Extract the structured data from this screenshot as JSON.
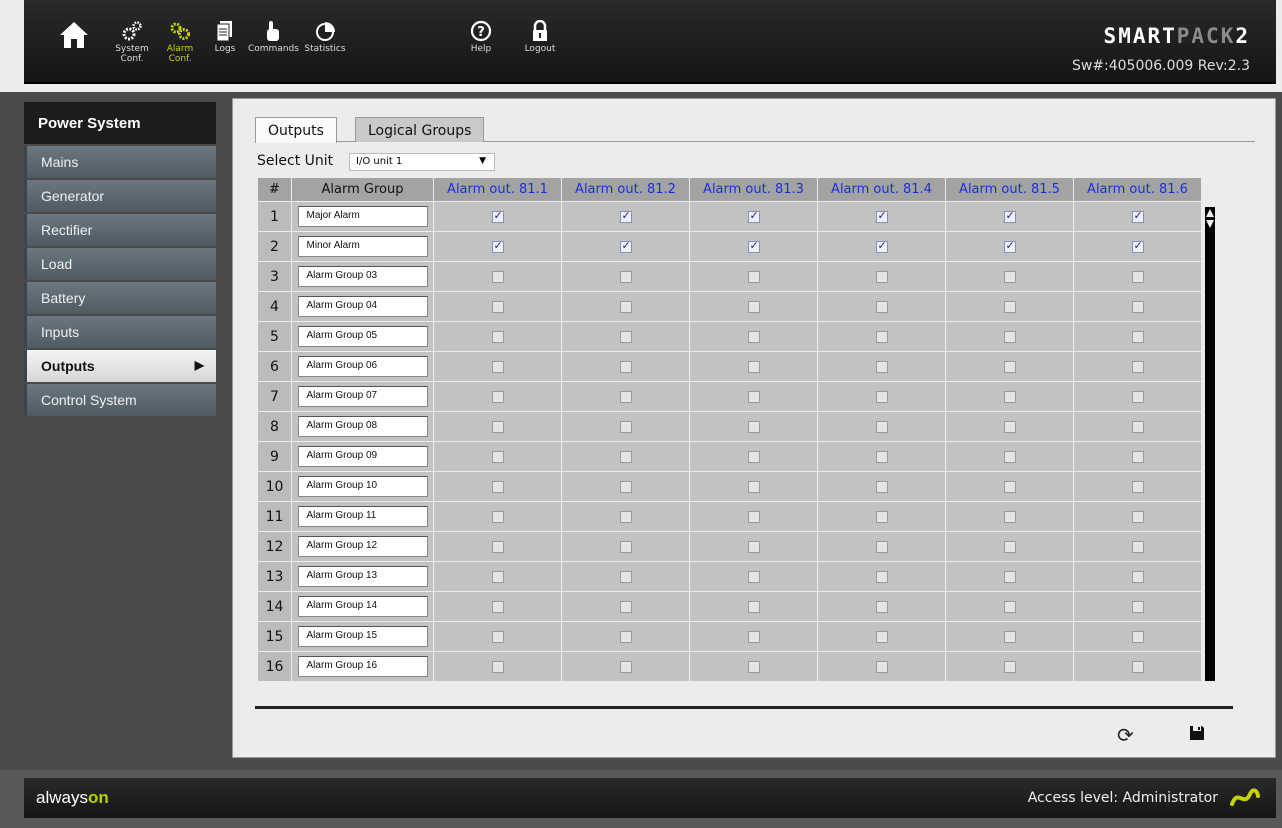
{
  "header": {
    "nav": [
      {
        "name": "home",
        "label1": "",
        "label2": ""
      },
      {
        "name": "system-conf",
        "label1": "System",
        "label2": "Conf."
      },
      {
        "name": "alarm-conf",
        "label1": "Alarm",
        "label2": "Conf."
      },
      {
        "name": "logs",
        "label1": "Logs",
        "label2": ""
      },
      {
        "name": "commands",
        "label1": "Commands",
        "label2": ""
      },
      {
        "name": "statistics",
        "label1": "Statistics",
        "label2": ""
      },
      {
        "name": "help",
        "label1": "Help",
        "label2": ""
      },
      {
        "name": "logout",
        "label1": "Logout",
        "label2": ""
      }
    ],
    "brand": {
      "part1": "SMART",
      "part2": "PACK",
      "part3": "2"
    },
    "version": "Sw#:405006.009 Rev:2.3"
  },
  "sidebar": {
    "title": "Power System",
    "items": [
      "Mains",
      "Generator",
      "Rectifier",
      "Load",
      "Battery",
      "Inputs",
      "Outputs",
      "Control System"
    ],
    "selected": "Outputs"
  },
  "tabs": [
    "Outputs",
    "Logical Groups"
  ],
  "select": {
    "label": "Select Unit",
    "value": "I/O unit 1"
  },
  "table": {
    "headers": [
      "#",
      "Alarm Group",
      "Alarm out. 81.1",
      "Alarm out. 81.2",
      "Alarm out. 81.3",
      "Alarm out. 81.4",
      "Alarm out. 81.5",
      "Alarm out. 81.6"
    ],
    "rows": [
      {
        "num": "1",
        "group": "Major Alarm",
        "checks": [
          true,
          true,
          true,
          true,
          true,
          true
        ]
      },
      {
        "num": "2",
        "group": "Minor Alarm",
        "checks": [
          true,
          true,
          true,
          true,
          true,
          true
        ]
      },
      {
        "num": "3",
        "group": "Alarm Group 03",
        "checks": [
          false,
          false,
          false,
          false,
          false,
          false
        ]
      },
      {
        "num": "4",
        "group": "Alarm Group 04",
        "checks": [
          false,
          false,
          false,
          false,
          false,
          false
        ]
      },
      {
        "num": "5",
        "group": "Alarm Group 05",
        "checks": [
          false,
          false,
          false,
          false,
          false,
          false
        ]
      },
      {
        "num": "6",
        "group": "Alarm Group 06",
        "checks": [
          false,
          false,
          false,
          false,
          false,
          false
        ]
      },
      {
        "num": "7",
        "group": "Alarm Group 07",
        "checks": [
          false,
          false,
          false,
          false,
          false,
          false
        ]
      },
      {
        "num": "8",
        "group": "Alarm Group 08",
        "checks": [
          false,
          false,
          false,
          false,
          false,
          false
        ]
      },
      {
        "num": "9",
        "group": "Alarm Group 09",
        "checks": [
          false,
          false,
          false,
          false,
          false,
          false
        ]
      },
      {
        "num": "10",
        "group": "Alarm Group 10",
        "checks": [
          false,
          false,
          false,
          false,
          false,
          false
        ]
      },
      {
        "num": "11",
        "group": "Alarm Group 11",
        "checks": [
          false,
          false,
          false,
          false,
          false,
          false
        ]
      },
      {
        "num": "12",
        "group": "Alarm Group 12",
        "checks": [
          false,
          false,
          false,
          false,
          false,
          false
        ]
      },
      {
        "num": "13",
        "group": "Alarm Group 13",
        "checks": [
          false,
          false,
          false,
          false,
          false,
          false
        ]
      },
      {
        "num": "14",
        "group": "Alarm Group 14",
        "checks": [
          false,
          false,
          false,
          false,
          false,
          false
        ]
      },
      {
        "num": "15",
        "group": "Alarm Group 15",
        "checks": [
          false,
          false,
          false,
          false,
          false,
          false
        ]
      },
      {
        "num": "16",
        "group": "Alarm Group 16",
        "checks": [
          false,
          false,
          false,
          false,
          false,
          false
        ]
      }
    ]
  },
  "footer": {
    "always": "always",
    "on": "on",
    "access": "Access level: Administrator"
  },
  "colors": {
    "accent": "#c8d400",
    "header_link": "#1a2fd8"
  }
}
